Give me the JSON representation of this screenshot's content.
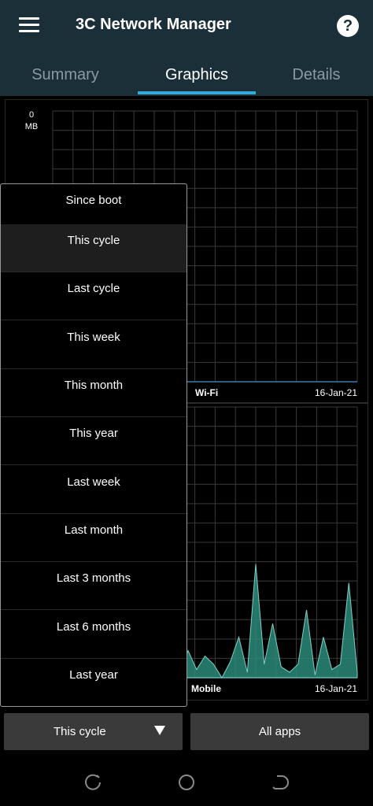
{
  "app": {
    "title": "3C Network Manager"
  },
  "tabs": [
    {
      "label": "Summary",
      "active": false
    },
    {
      "label": "Graphics",
      "active": true
    },
    {
      "label": "Details",
      "active": false
    }
  ],
  "charts": [
    {
      "label": "Wi-Fi",
      "date": "16-Jan-21",
      "y_top_value": "0",
      "y_unit": "MB"
    },
    {
      "label": "Mobile",
      "date": "16-Jan-21"
    }
  ],
  "chart_data": [
    {
      "type": "area",
      "title": "Wi-Fi",
      "xlabel": "16-Jan-21",
      "y_axis_top": "0",
      "y_unit": "MB",
      "values": [],
      "grid": true
    },
    {
      "type": "area",
      "title": "Mobile",
      "xlabel": "16-Jan-21",
      "relative_values": [
        0,
        0,
        0.03,
        0.01,
        0.04,
        0.03,
        0,
        0.01,
        0.05,
        0.1,
        0.05,
        0.06,
        0.4,
        0.02,
        0.47,
        0.02,
        0.1,
        0.03,
        0.08,
        0.05,
        0,
        0.06,
        0.15,
        0.02,
        0.42,
        0.05,
        0.2,
        0.04,
        0.02,
        0.05,
        0.25,
        0.01,
        0.15,
        0.03,
        0.05,
        0.35,
        0.02
      ],
      "color": "#2a8a7a",
      "grid": true
    }
  ],
  "period_menu": {
    "items": [
      "Since boot",
      "This cycle",
      "Last cycle",
      "This week",
      "This month",
      "This year",
      "Last week",
      "Last month",
      "Last 3 months",
      "Last 6 months",
      "Last year"
    ],
    "selected": "This cycle"
  },
  "buttons": {
    "period_label": "This cycle",
    "apps_label": "All apps"
  },
  "icons": {
    "menu": "hamburger-icon",
    "help": "help-icon",
    "dropdown": "dropdown-triangle-icon",
    "nav_recent": "recent-apps-icon",
    "nav_home": "home-icon",
    "nav_back": "back-icon"
  },
  "colors": {
    "appbar": "#1b2f38",
    "tab_indicator": "#35a9d9",
    "grid": "#3a3a3a",
    "axis": "#3d7fa0",
    "mobile_fill": "#2a8a7a",
    "button": "#3a3a3a"
  },
  "help_glyph": "?"
}
